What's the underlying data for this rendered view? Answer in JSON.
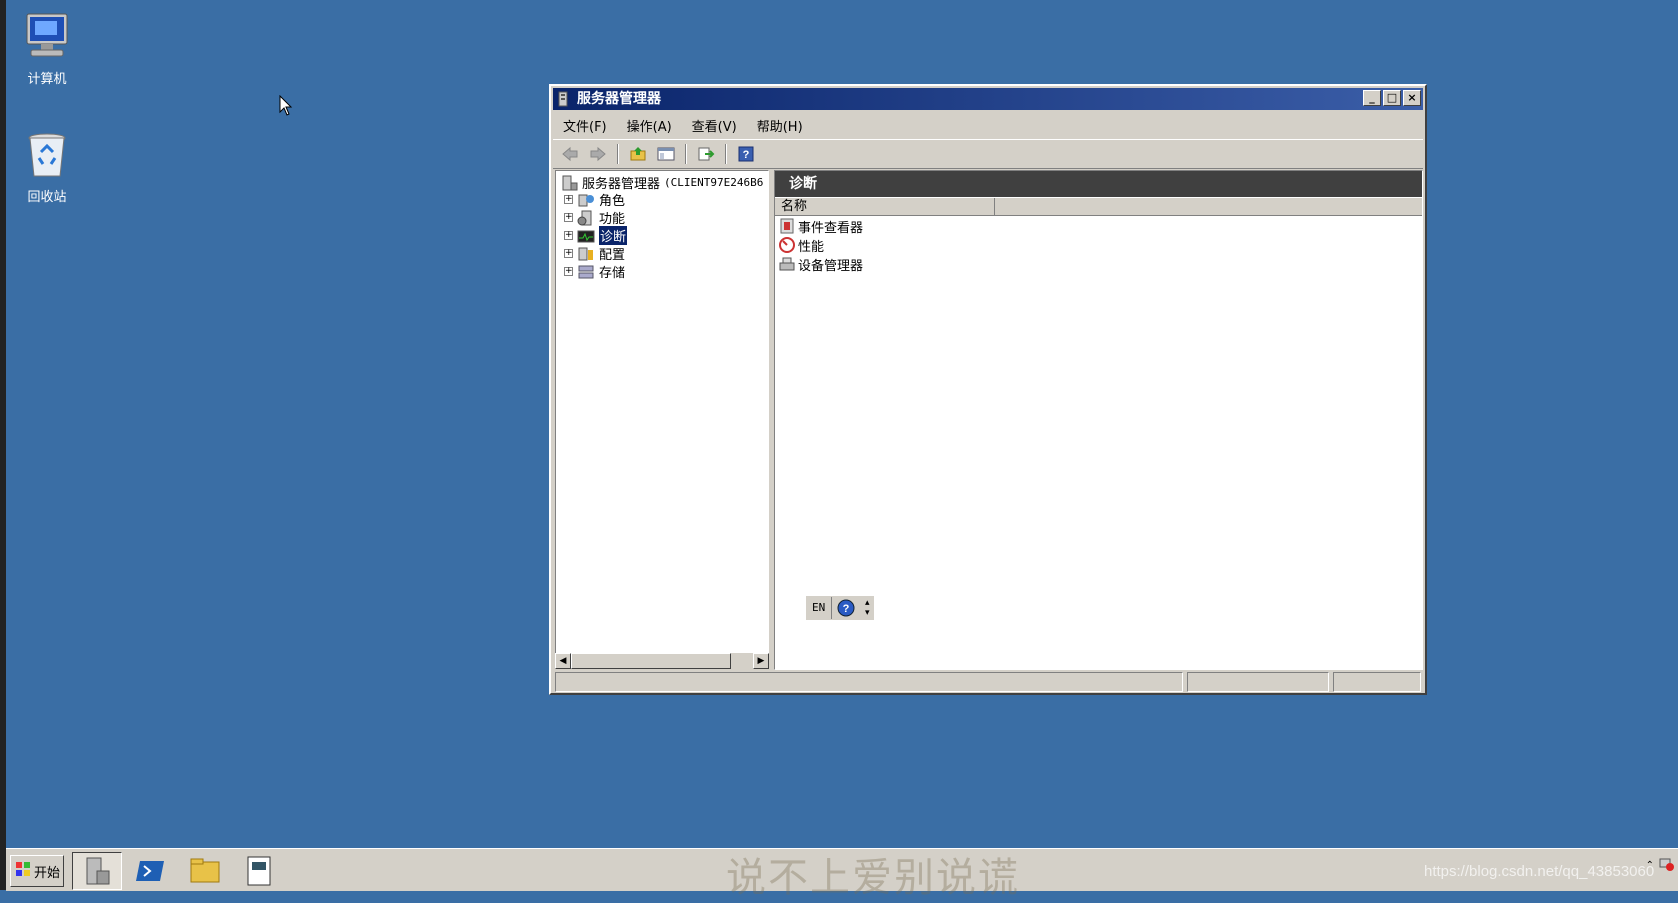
{
  "desktop": {
    "icons": [
      {
        "label": "计算机"
      },
      {
        "label": "回收站"
      }
    ]
  },
  "window": {
    "title": "服务器管理器",
    "controls": {
      "minimize": "_",
      "maximize": "□",
      "close": "×"
    },
    "menu": [
      "文件(F)",
      "操作(A)",
      "查看(V)",
      "帮助(H)"
    ],
    "tree": {
      "root_label": "服务器管理器",
      "root_host": "(CLIENT97E246B6",
      "nodes": [
        {
          "label": "角色"
        },
        {
          "label": "功能"
        },
        {
          "label": "诊断",
          "selected": true
        },
        {
          "label": "配置"
        },
        {
          "label": "存储"
        }
      ]
    },
    "content": {
      "header": "诊断",
      "columns": [
        "名称",
        ""
      ],
      "items": [
        {
          "label": "事件查看器"
        },
        {
          "label": "性能"
        },
        {
          "label": "设备管理器"
        }
      ]
    },
    "langbar": {
      "lang": "EN"
    }
  },
  "taskbar": {
    "start_label": "开始",
    "watermark_text": "说不上爱别说谎",
    "watermark_url": "https://blog.csdn.net/qq_43853060"
  },
  "colors": {
    "desktop": "#3a6ea5",
    "titlebar_start": "#0a246a",
    "titlebar_end": "#3b5ea8",
    "selection": "#0a246a",
    "content_header": "#404040"
  }
}
